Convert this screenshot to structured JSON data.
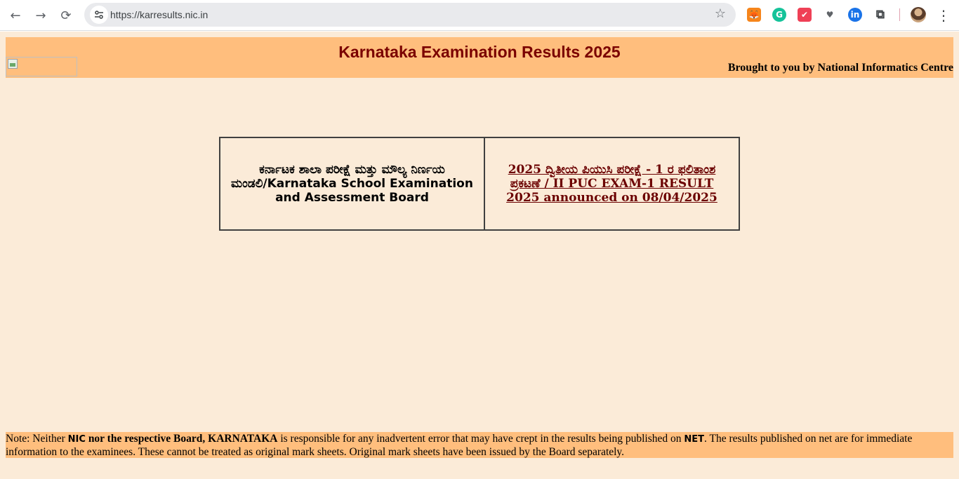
{
  "browser": {
    "url": "https://karresults.nic.in",
    "icons": {
      "back": "arrow-left-icon",
      "forward": "arrow-right-icon",
      "reload": "reload-icon",
      "site_info": "tune-icon",
      "bookmark": "star-icon",
      "extensions": [
        "metamask-icon",
        "grammarly-icon",
        "pocket-icon",
        "extension-badge-icon",
        "linkedin-extension-icon",
        "puzzle-icon"
      ],
      "menu": "kebab-menu-icon"
    }
  },
  "header": {
    "title": "Karnataka Examination Results 2025",
    "credit": "Brought to you by National Informatics Centre"
  },
  "board_table": {
    "board_name": "ಕರ್ನಾಟಕ ಶಾಲಾ ಪರೀಕ್ಷೆ ಮತ್ತು ಮೌಲ್ಯ ನಿರ್ಣಯ ಮಂಡಲಿ/Karnataka School Examination and Assessment Board",
    "result_link": "2025 ದ್ವಿತೀಯ ಪಿಯುಸಿ ಪರೀಕ್ಷೆ - 1 ರ ಫಲಿತಾಂಶ ಪ್ರಕಟಣೆ / II PUC EXAM-1 RESULT 2025 announced on 08/04/2025"
  },
  "note": {
    "prefix": "Note: Neither ",
    "nic": "NIC",
    "bold_mid": " nor the respective Board, KARNATAKA",
    "middle": " is responsible for any inadvertent error that may have crept in the results being published on ",
    "net": "NET",
    "suffix": ". The results published on net are for immediate information to the examinees. These cannot be treated as original mark sheets. Original mark sheets have been issued by the Board separately."
  },
  "colors": {
    "page_bg": "#fbebd8",
    "band_bg": "#ffbe7d",
    "title": "#7a0000",
    "link": "#6b0000"
  }
}
